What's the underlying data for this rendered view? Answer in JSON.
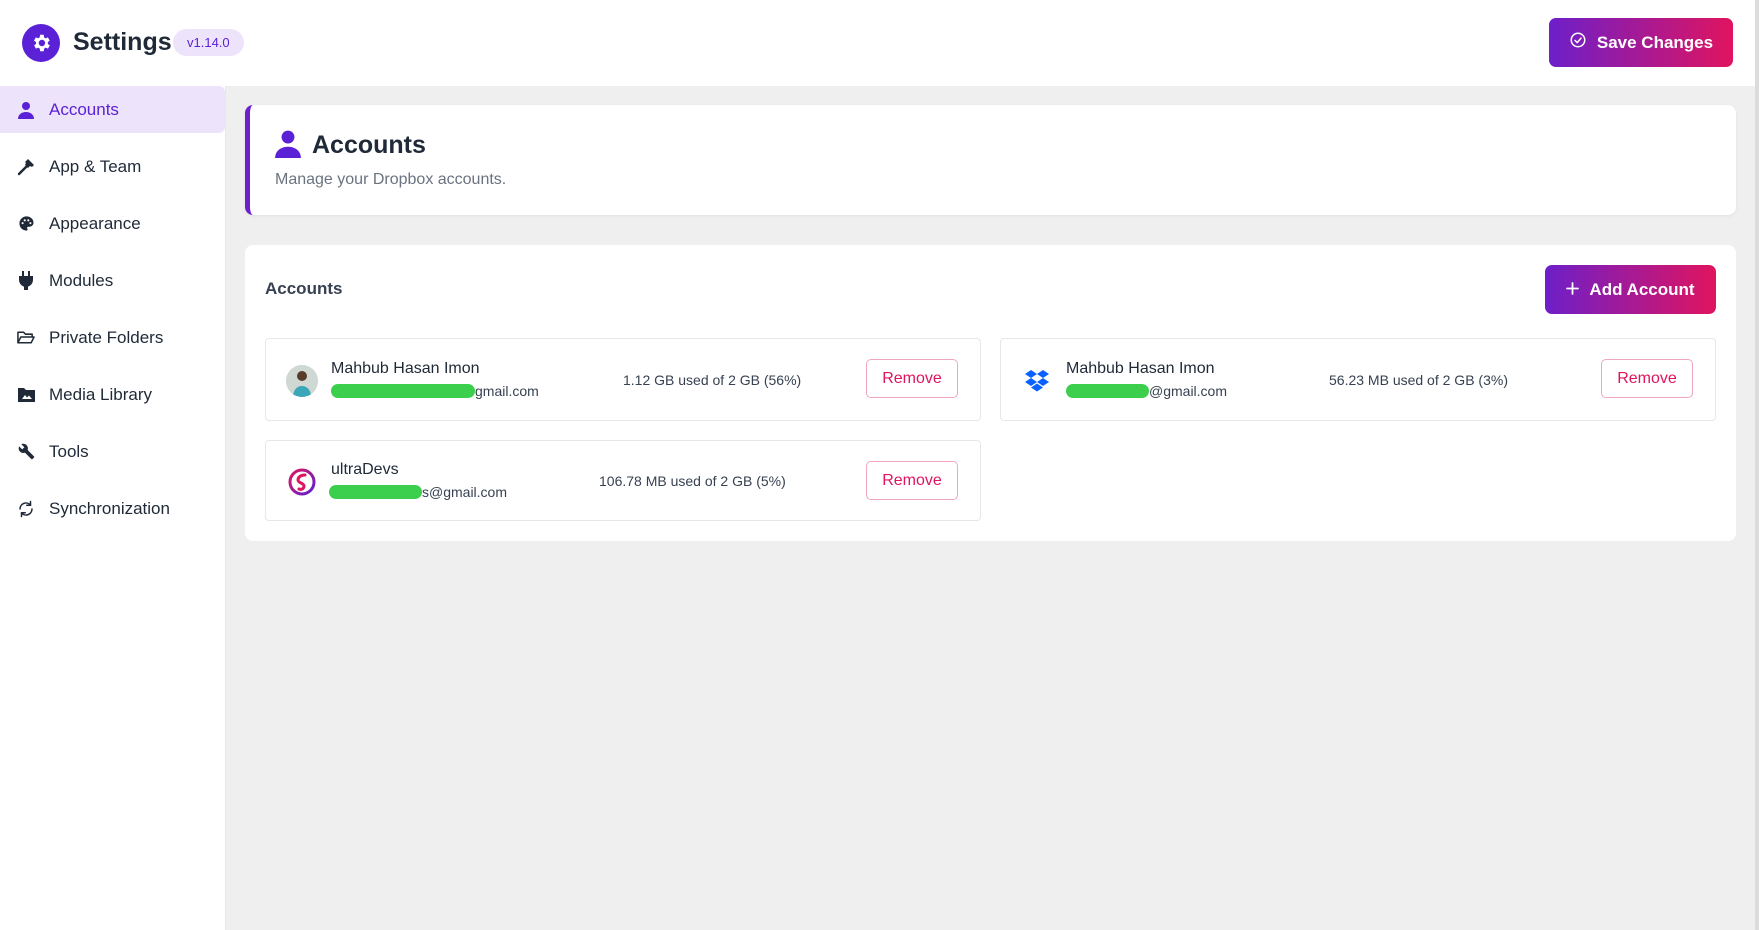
{
  "header": {
    "title": "Settings",
    "version": "v1.14.0",
    "save_label": "Save Changes"
  },
  "sidebar": {
    "items": [
      {
        "label": "Accounts",
        "icon": "user-icon",
        "active": true
      },
      {
        "label": "App & Team",
        "icon": "hammer-icon",
        "active": false
      },
      {
        "label": "Appearance",
        "icon": "palette-icon",
        "active": false
      },
      {
        "label": "Modules",
        "icon": "plug-icon",
        "active": false
      },
      {
        "label": "Private Folders",
        "icon": "folder-open-icon",
        "active": false
      },
      {
        "label": "Media Library",
        "icon": "photo-folder-icon",
        "active": false
      },
      {
        "label": "Tools",
        "icon": "wrench-icon",
        "active": false
      },
      {
        "label": "Synchronization",
        "icon": "sync-icon",
        "active": false
      }
    ]
  },
  "intro": {
    "title": "Accounts",
    "description": "Manage your Dropbox accounts."
  },
  "accounts_panel": {
    "title": "Accounts",
    "add_label": "Add Account",
    "accounts": [
      {
        "name": "Mahbub Hasan Imon",
        "email_suffix": "gmail.com",
        "usage": "1.12 GB used of 2 GB (56%)",
        "avatar": "user-photo-icon",
        "remove_label": "Remove"
      },
      {
        "name": "Mahbub Hasan Imon",
        "email_suffix": "@gmail.com",
        "usage": "56.23 MB used of 2 GB (3%)",
        "avatar": "dropbox-icon",
        "remove_label": "Remove"
      },
      {
        "name": "ultraDevs",
        "email_suffix": "s@gmail.com",
        "usage": "106.78 MB used of 2 GB (5%)",
        "avatar": "ultradevs-logo-icon",
        "remove_label": "Remove"
      }
    ]
  },
  "colors": {
    "accent": "#5b21d6",
    "gradient_start": "#6d1fc9",
    "gradient_end": "#e0145f",
    "danger": "#e0145f",
    "redaction": "#3ccf4e"
  }
}
